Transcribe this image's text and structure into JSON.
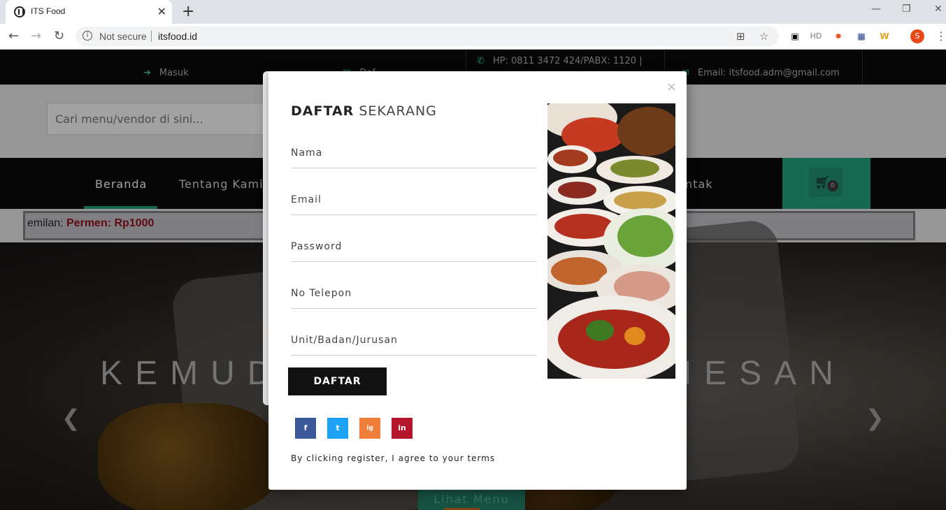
{
  "browser": {
    "tab_title": "ITS Food",
    "tab_close": "✕",
    "new_tab": "+",
    "security_label": "Not secure",
    "url": "itsfood.id",
    "profile_initial": "S",
    "ext_hd": "HD"
  },
  "topbar": {
    "login": "Masuk",
    "partial": "Daf",
    "phone_line1": "HP: 0811 3472 424/PABX: 1120 |",
    "email": "Email: itsfood.adm@gmail.com"
  },
  "search": {
    "placeholder": "Cari menu/vendor di sini..."
  },
  "nav": {
    "items": [
      "Beranda",
      "Tentang Kami",
      "ntak"
    ],
    "cart_count": "0"
  },
  "ticker": {
    "prefix": "emilan: ",
    "highlight": "Permen: Rp1000"
  },
  "hero": {
    "left_text": "KEMUD",
    "right_text": "MESAN",
    "button_label": "Lihat Menu"
  },
  "modal": {
    "close": "×",
    "title_bold": "DAFTAR",
    "title_rest": "SEKARANG",
    "fields": [
      "Nama",
      "Email",
      "Password",
      "No Telepon",
      "Unit/Badan/Jurusan"
    ],
    "submit_label": "DAFTAR",
    "social": [
      "f",
      "t",
      "ig",
      "in"
    ],
    "terms": "By clicking register, I agree to your terms"
  },
  "colors": {
    "accent": "#1f8d6e",
    "facebook": "#3b5998",
    "twitter": "#1da1f2",
    "instagram": "#f07f3c",
    "linkedin": "#b3152b"
  }
}
